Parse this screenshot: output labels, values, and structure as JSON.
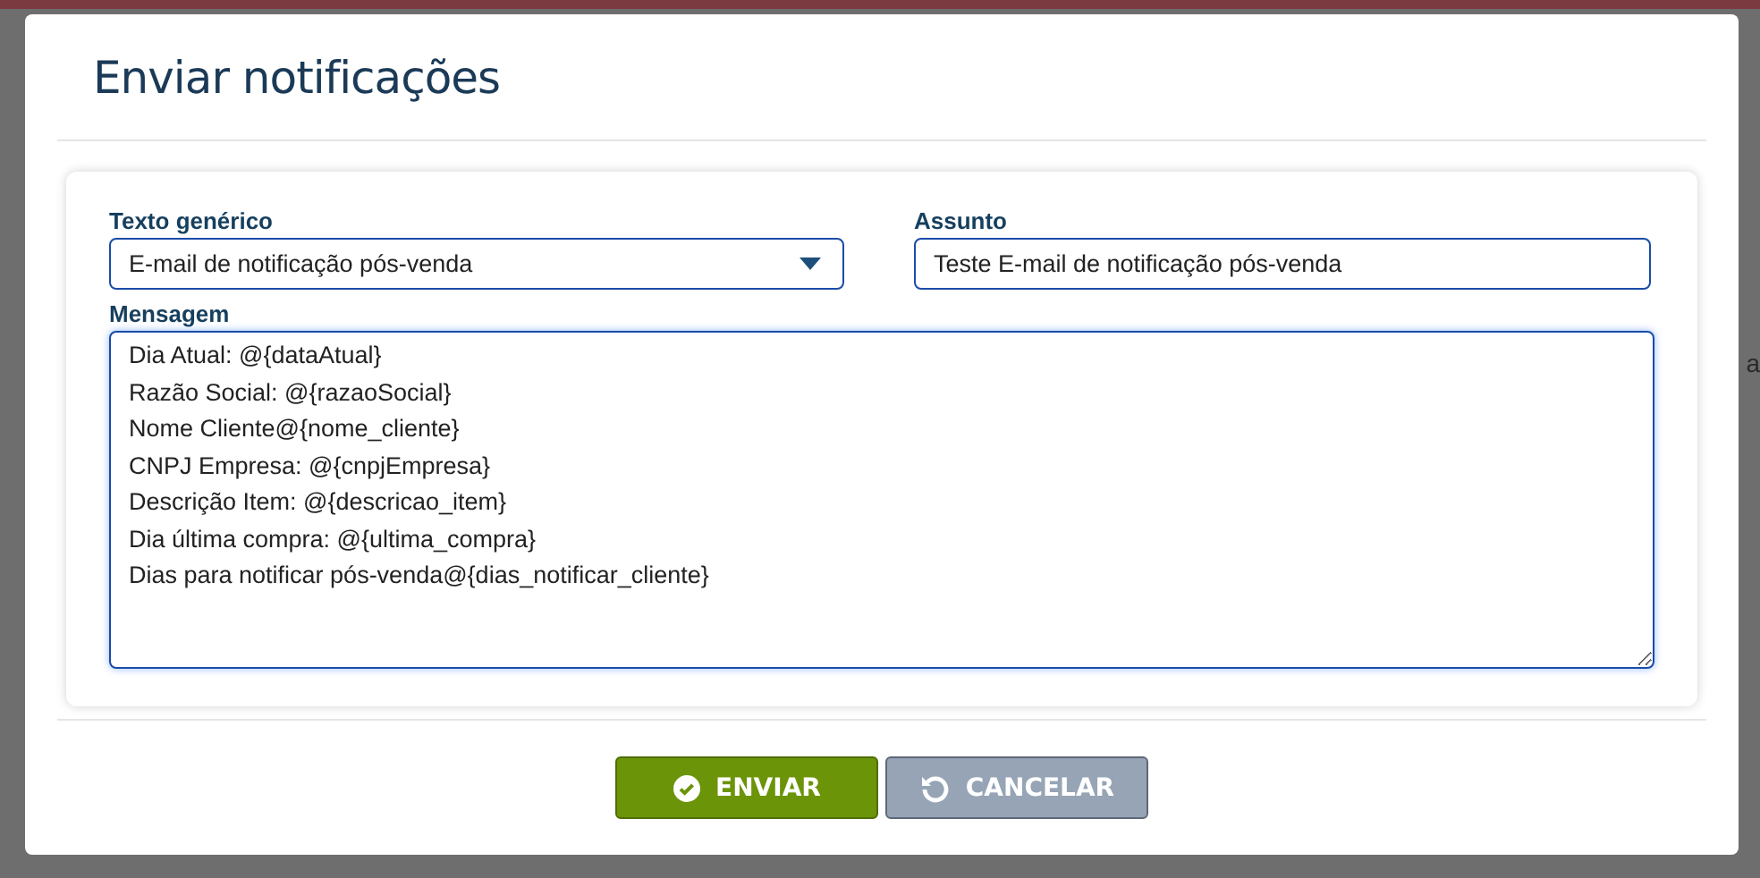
{
  "backdrop": {
    "fragment": "a"
  },
  "dialog": {
    "title": "Enviar notificações"
  },
  "form": {
    "generic_text": {
      "label": "Texto genérico",
      "value": "E-mail de notificação pós-venda"
    },
    "subject": {
      "label": "Assunto",
      "value": "Teste E-mail de notificação pós-venda"
    },
    "message": {
      "label": "Mensagem",
      "lines": [
        "Dia Atual: @{dataAtual}",
        "Razão Social: @{razaoSocial}",
        "Nome Cliente@{nome_cliente}",
        "CNPJ Empresa: @{cnpjEmpresa}",
        "Descrição Item: @{descricao_item}",
        "Dia última compra: @{ultima_compra}",
        "Dias para notificar pós-venda@{dias_notificar_cliente}"
      ]
    }
  },
  "buttons": [
    {
      "kind": "send",
      "label": "ENVIAR"
    },
    {
      "kind": "cancel",
      "label": "CANCELAR"
    }
  ]
}
